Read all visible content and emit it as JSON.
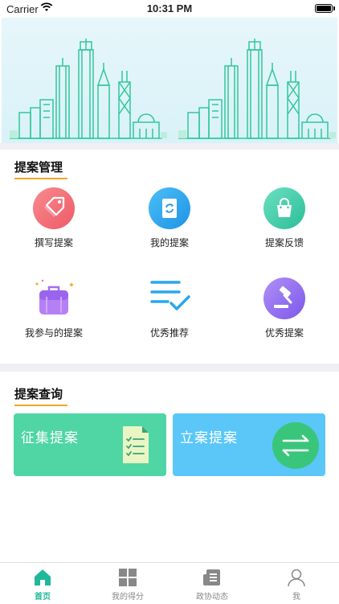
{
  "status_bar": {
    "carrier": "Carrier",
    "time": "10:31 PM"
  },
  "section_manage": {
    "title": "提案管理",
    "items": [
      {
        "label": "撰写提案",
        "icon": "tag-icon",
        "color": "#f2656e"
      },
      {
        "label": "我的提案",
        "icon": "document-refresh-icon",
        "color": "#2aa6ee"
      },
      {
        "label": "提案反馈",
        "icon": "shopping-bag-icon",
        "color": "#3fc9a6"
      },
      {
        "label": "我参与的提案",
        "icon": "briefcase-icon",
        "color": "#a76cf0"
      },
      {
        "label": "优秀推荐",
        "icon": "list-check-icon",
        "color": "#2aa6ee"
      },
      {
        "label": "优秀提案",
        "icon": "gavel-icon",
        "color": "#8c6ff0"
      }
    ]
  },
  "section_query": {
    "title": "提案查询",
    "cards": [
      {
        "label": "征集提案",
        "color": "#4fd6a4",
        "icon": "checklist-document-icon"
      },
      {
        "label": "立案提案",
        "color": "#5bc7f8",
        "icon": "swap-arrows-icon"
      }
    ]
  },
  "tabbar": {
    "tabs": [
      {
        "label": "首页",
        "icon": "home-icon",
        "active": true
      },
      {
        "label": "我的得分",
        "icon": "grid-icon",
        "active": false
      },
      {
        "label": "政协动态",
        "icon": "news-icon",
        "active": false
      },
      {
        "label": "我",
        "icon": "user-icon",
        "active": false
      }
    ],
    "active_color": "#1fb89a"
  }
}
